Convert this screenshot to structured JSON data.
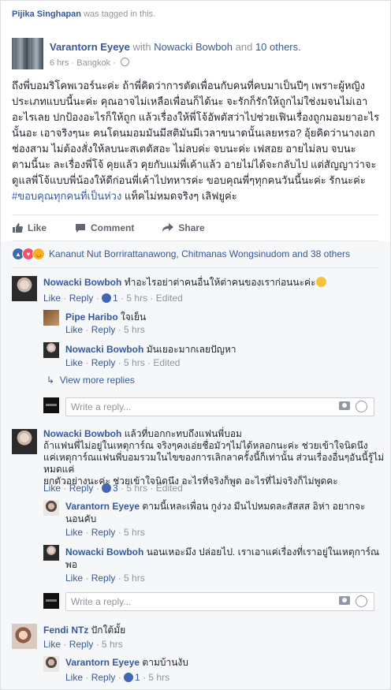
{
  "tagline": {
    "name": "Pijika Singhapan",
    "text": "was tagged in this."
  },
  "post": {
    "author": "Varantorn Eyeye",
    "with_text": "with",
    "with_name": "Nowacki Bowboh",
    "and_text": "and",
    "others": "10 others",
    "time": "6 hrs",
    "place": "Bangkok",
    "body": "ถึงพี่บอมริโคพเวอร์นะค่ะ ถ้าพี่คิดว่าการตัดเพื่อนกับคนที่คบมาเป็นปีๆ เพราะผู้หญิง\nประเภทแบบนี้นะค่ะ คุณอาจไม่เหลือเพื่อนก็ได้นะ จะรักก็รักให้ถูกไม่ใช่งมจนไม่เอา\nอะไรเลย ปกป้องอะไรก็ให้ถูก แล้วเรื่องให้พี่โจ้อัพตัสว่าไปช่วยเฟินเรื่องถูกมอมยาอะไร\nนั้นอะ เอาจริงๆนะ คนโดนมอมมันมีสติมันมีเวลาขนาดนั้นเลยหรอ? อุ้ยคิดว่านางเอก\nช่องสาม ไม่ต้องสั่งให้ลบนะสเตตัสอะ ไม่ลบค่ะ จบนะค่ะ เฟสอย อายไม่ลบ จบนะ\nตามนี้นะ ละเรื่องพี่โจ้ คุยแล้ว คุยกับแม่พี่เค้าแล้ว อายไม่ได้จะกลับไป แต่สัญญาว่าจะ\nดูแลพี่โจ้แบบพี่น้องให้ดีก่อนพี่เค้าไปทหารค่ะ ขอบคุณพี่ๆทุกคนวันนี้นะค่ะ รักนะค่ะ",
    "hashtag": "#ขอบคุณทุกคนที่เป็นห่วง",
    "tag_suffix": "แท็คไม่หมดจริงๆ เลิฟยูค่ะ",
    "actions": {
      "like": "Like",
      "comment": "Comment",
      "share": "Share"
    }
  },
  "reactions": {
    "text": "Kananut Nut Borrirattanawong, Chitmanas Wongsinudom and 38 others"
  },
  "comments": [
    {
      "name": "Nowacki Bowboh",
      "text": "ทำอะไรอย่าต่าคนอื่นให้ต่าคนของเราก่อนนะค่ะ",
      "like": "Like",
      "reply": "Reply",
      "likes": "1",
      "time": "5 hrs",
      "edited": "Edited",
      "replies": [
        {
          "name": "Pipe Haribo",
          "text": "ใจเย็น",
          "like": "Like",
          "reply": "Reply",
          "time": "5 hrs"
        },
        {
          "name": "Nowacki Bowboh",
          "text": "มันเยอะมากเลยปัญหา",
          "like": "Like",
          "reply": "Reply",
          "time": "5 hrs",
          "edited": "Edited"
        }
      ],
      "more": "View more replies"
    },
    {
      "name": "Nowacki Bowboh",
      "text": "แล้วที่บอกกะทบถึงแฟนพี่บอม\nถ้าแฟนพี่ไม่อยู่ในเหตุการ์ณ จริงๆคงเอ่ยชื่อมัวๆไม่ได้หลอกนะค่ะ ช่วยเข้าใจนิดนึง\nแค่เหตุการ์ณแฟนพี่บอมรวมในไขของการเลิกลาครั้งนี้ก็เท่านั้น ส่วนเรื่องอื่นๆอันนี้รู้ไม่หมดแค่\nยกตัวอย่างนะค่ะ ช่วยเข้าใจนิดนึง อะไรที่จริงก็พูด อะไรที่ไม่จริงก็ไม่พูดคะ",
      "like": "Like",
      "reply": "Reply",
      "likes": "3",
      "time": "5 hrs",
      "edited": "Edited",
      "replies": [
        {
          "name": "Varantorn Eyeye",
          "text": "ตามนี้เหละเพื่อน กูง่วง มีนไปหมดละสัสสส อิห่า อยากจะ\nนอนคับ",
          "like": "Like",
          "reply": "Reply",
          "time": "5 hrs"
        },
        {
          "name": "Nowacki Bowboh",
          "text": "นอนเหอะมึง ปล่อยไป. เราเอาแค่เรื่องที่เราอยู่ในเหตุการ์ณ\nพอ",
          "like": "Like",
          "reply": "Reply",
          "time": "5 hrs"
        }
      ]
    },
    {
      "name": "Fendi NTz",
      "text": "ปักใต้มั้ย",
      "like": "Like",
      "reply": "Reply",
      "time": "5 hrs",
      "replies": [
        {
          "name": "Varantorn Eyeye",
          "text": "ตามบ้านงับ",
          "like": "Like",
          "reply": "Reply",
          "likes": "1",
          "time": "5 hrs"
        }
      ]
    }
  ],
  "reply_box": {
    "placeholder": "Write a reply..."
  }
}
